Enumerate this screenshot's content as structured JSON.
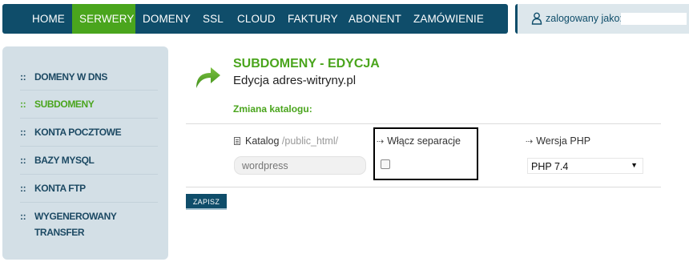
{
  "nav": {
    "items": [
      {
        "label": "HOME",
        "active": false
      },
      {
        "label": "SERWERY",
        "active": true
      },
      {
        "label": "DOMENY",
        "active": false
      },
      {
        "label": "SSL",
        "active": false
      },
      {
        "label": "CLOUD",
        "active": false
      },
      {
        "label": "FAKTURY",
        "active": false
      },
      {
        "label": "ABONENT",
        "active": false
      },
      {
        "label": "ZAMÓWIENIE",
        "active": false
      }
    ],
    "user_label": "zalogowany jako:"
  },
  "sidebar": {
    "bullet": "::",
    "items": [
      {
        "label": "DOMENY W DNS",
        "active": false
      },
      {
        "label": "SUBDOMENY",
        "active": true
      },
      {
        "label": "KONTA POCZTOWE",
        "active": false
      },
      {
        "label": "BAZY MYSQL",
        "active": false
      },
      {
        "label": "KONTA FTP",
        "active": false
      },
      {
        "label": "WYGENEROWANY TRANSFER",
        "active": false
      }
    ]
  },
  "main": {
    "title": "SUBDOMENY - EDYCJA",
    "subtitle": "Edycja adres-witryny.pl",
    "section_title": "Zmiana katalogu:",
    "catalog_label": "Katalog",
    "catalog_hint": "/public_html/",
    "catalog_placeholder": "wordpress",
    "separation_label": "Włącz separacje",
    "separation_checked": false,
    "php_label": "Wersja PHP",
    "php_selected": "PHP 7.4",
    "save_label": "ZAPISZ"
  },
  "colors": {
    "primary": "#0f4d6a",
    "accent": "#4aa51d",
    "sidebar_bg": "#d3dfe6"
  }
}
